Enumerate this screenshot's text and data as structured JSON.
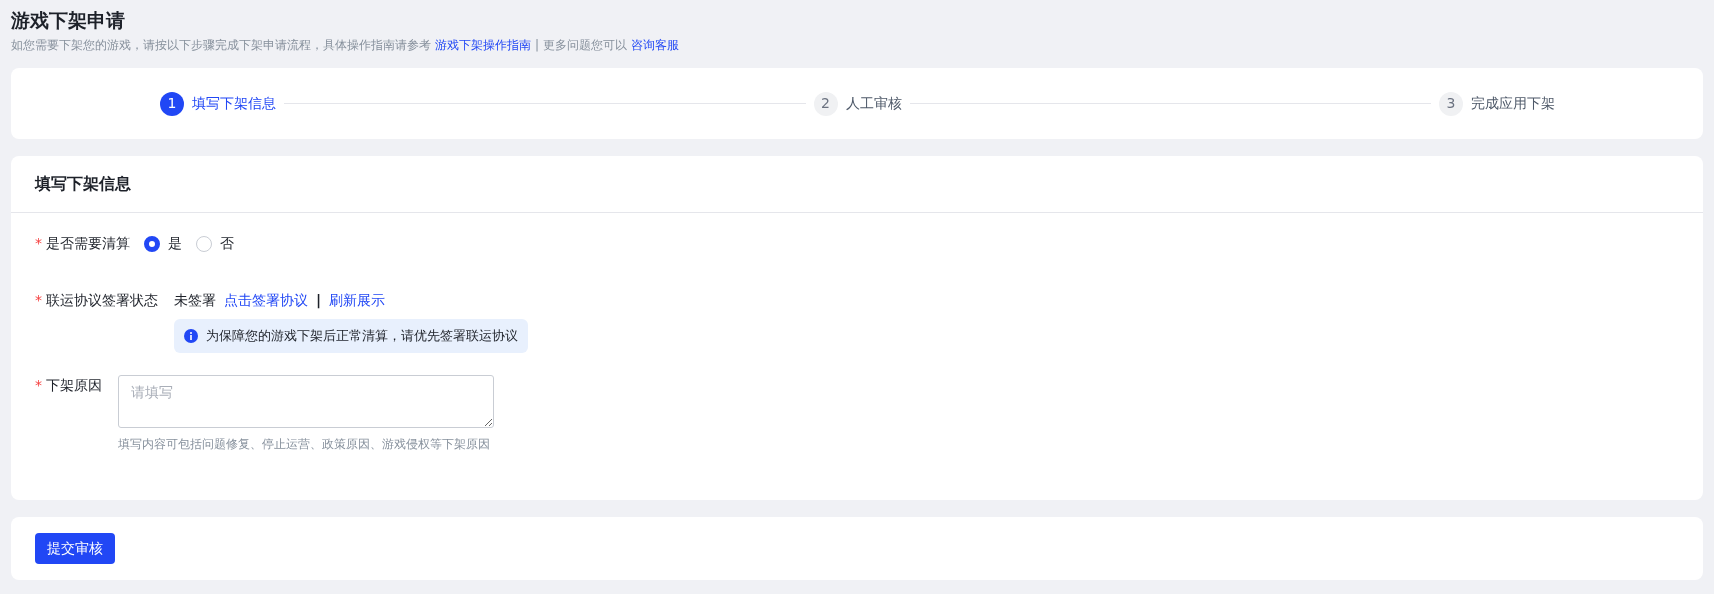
{
  "page": {
    "title": "游戏下架申请",
    "intro": "如您需要下架您的游戏，请按以下步骤完成下架申请流程，具体操作指南请参考",
    "guide_link": "游戏下架操作指南",
    "separator": "|",
    "more": "更多问题您可以",
    "service_link": "咨询客服"
  },
  "steps": [
    {
      "number": "1",
      "label": "填写下架信息",
      "selected": true
    },
    {
      "number": "2",
      "label": "人工审核",
      "selected": false
    },
    {
      "number": "3",
      "label": "完成应用下架",
      "selected": false
    }
  ],
  "form": {
    "title": "填写下架信息",
    "settle": {
      "label": "是否需要清算",
      "required_mark": "*",
      "options": [
        {
          "label": "是",
          "selected": true
        },
        {
          "label": "否",
          "selected": false
        }
      ]
    },
    "agreement": {
      "label": "联运协议签署状态",
      "required_mark": "*",
      "status": "未签署",
      "sign_link": "点击签署协议",
      "separator": "|",
      "refresh_link": "刷新展示",
      "notice": "为保障您的游戏下架后正常清算，请优先签署联运协议"
    },
    "reason": {
      "label": "下架原因",
      "required_mark": "*",
      "placeholder": "请填写",
      "hint": "填写内容可包括问题修复、停止运营、政策原因、游戏侵权等下架原因"
    }
  },
  "submit": "提交审核"
}
